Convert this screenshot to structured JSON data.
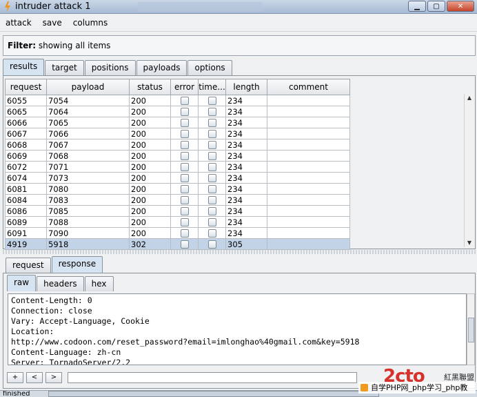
{
  "window": {
    "title": "intruder attack 1"
  },
  "menu": {
    "items": [
      "attack",
      "save",
      "columns"
    ]
  },
  "filter": {
    "label": "Filter:",
    "value": "showing all items"
  },
  "top_tabs": [
    "results",
    "target",
    "positions",
    "payloads",
    "options"
  ],
  "table": {
    "columns": [
      "request",
      "payload",
      "status",
      "error",
      "time...",
      "length",
      "comment"
    ],
    "rows": [
      {
        "request": "6055",
        "payload": "7054",
        "status": "200",
        "length": "234"
      },
      {
        "request": "6065",
        "payload": "7064",
        "status": "200",
        "length": "234"
      },
      {
        "request": "6066",
        "payload": "7065",
        "status": "200",
        "length": "234"
      },
      {
        "request": "6067",
        "payload": "7066",
        "status": "200",
        "length": "234"
      },
      {
        "request": "6068",
        "payload": "7067",
        "status": "200",
        "length": "234"
      },
      {
        "request": "6069",
        "payload": "7068",
        "status": "200",
        "length": "234"
      },
      {
        "request": "6072",
        "payload": "7071",
        "status": "200",
        "length": "234"
      },
      {
        "request": "6074",
        "payload": "7073",
        "status": "200",
        "length": "234"
      },
      {
        "request": "6081",
        "payload": "7080",
        "status": "200",
        "length": "234"
      },
      {
        "request": "6084",
        "payload": "7083",
        "status": "200",
        "length": "234"
      },
      {
        "request": "6086",
        "payload": "7085",
        "status": "200",
        "length": "234"
      },
      {
        "request": "6089",
        "payload": "7088",
        "status": "200",
        "length": "234"
      },
      {
        "request": "6091",
        "payload": "7090",
        "status": "200",
        "length": "234"
      },
      {
        "request": "4919",
        "payload": "5918",
        "status": "302",
        "length": "305",
        "selected": true
      }
    ]
  },
  "req_tabs": [
    "request",
    "response"
  ],
  "sub_tabs": [
    "raw",
    "headers",
    "hex"
  ],
  "response_lines": [
    "Content-Length: 0",
    "Connection: close",
    "Vary: Accept-Language, Cookie",
    "Location:",
    "http://www.codoon.com/reset_password?email=imlonghao%40gmail.com&key=5918",
    "Content-Language: zh-cn",
    "Server: TornadoServer/2.2"
  ],
  "search_buttons": [
    "+",
    "<",
    ">"
  ],
  "status": {
    "text": "finished"
  },
  "watermark": {
    "logo": "2cto",
    "sub": "紅黑聯盟",
    "line": "自学PHP网_php学习_php教"
  }
}
